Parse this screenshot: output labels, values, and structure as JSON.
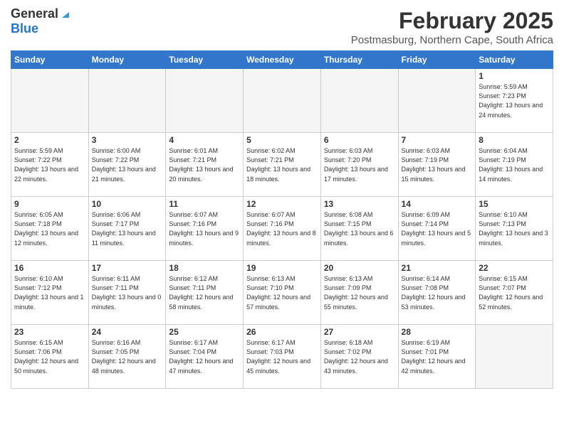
{
  "header": {
    "logo_general": "General",
    "logo_blue": "Blue",
    "main_title": "February 2025",
    "subtitle": "Postmasburg, Northern Cape, South Africa"
  },
  "days_of_week": [
    "Sunday",
    "Monday",
    "Tuesday",
    "Wednesday",
    "Thursday",
    "Friday",
    "Saturday"
  ],
  "weeks": [
    [
      {
        "day": "",
        "empty": true
      },
      {
        "day": "",
        "empty": true
      },
      {
        "day": "",
        "empty": true
      },
      {
        "day": "",
        "empty": true
      },
      {
        "day": "",
        "empty": true
      },
      {
        "day": "",
        "empty": true
      },
      {
        "day": "1",
        "sunrise": "5:59 AM",
        "sunset": "7:23 PM",
        "daylight": "13 hours and 24 minutes."
      }
    ],
    [
      {
        "day": "2",
        "sunrise": "5:59 AM",
        "sunset": "7:22 PM",
        "daylight": "13 hours and 22 minutes."
      },
      {
        "day": "3",
        "sunrise": "6:00 AM",
        "sunset": "7:22 PM",
        "daylight": "13 hours and 21 minutes."
      },
      {
        "day": "4",
        "sunrise": "6:01 AM",
        "sunset": "7:21 PM",
        "daylight": "13 hours and 20 minutes."
      },
      {
        "day": "5",
        "sunrise": "6:02 AM",
        "sunset": "7:21 PM",
        "daylight": "13 hours and 18 minutes."
      },
      {
        "day": "6",
        "sunrise": "6:03 AM",
        "sunset": "7:20 PM",
        "daylight": "13 hours and 17 minutes."
      },
      {
        "day": "7",
        "sunrise": "6:03 AM",
        "sunset": "7:19 PM",
        "daylight": "13 hours and 15 minutes."
      },
      {
        "day": "8",
        "sunrise": "6:04 AM",
        "sunset": "7:19 PM",
        "daylight": "13 hours and 14 minutes."
      }
    ],
    [
      {
        "day": "9",
        "sunrise": "6:05 AM",
        "sunset": "7:18 PM",
        "daylight": "13 hours and 12 minutes."
      },
      {
        "day": "10",
        "sunrise": "6:06 AM",
        "sunset": "7:17 PM",
        "daylight": "13 hours and 11 minutes."
      },
      {
        "day": "11",
        "sunrise": "6:07 AM",
        "sunset": "7:16 PM",
        "daylight": "13 hours and 9 minutes."
      },
      {
        "day": "12",
        "sunrise": "6:07 AM",
        "sunset": "7:16 PM",
        "daylight": "13 hours and 8 minutes."
      },
      {
        "day": "13",
        "sunrise": "6:08 AM",
        "sunset": "7:15 PM",
        "daylight": "13 hours and 6 minutes."
      },
      {
        "day": "14",
        "sunrise": "6:09 AM",
        "sunset": "7:14 PM",
        "daylight": "13 hours and 5 minutes."
      },
      {
        "day": "15",
        "sunrise": "6:10 AM",
        "sunset": "7:13 PM",
        "daylight": "13 hours and 3 minutes."
      }
    ],
    [
      {
        "day": "16",
        "sunrise": "6:10 AM",
        "sunset": "7:12 PM",
        "daylight": "13 hours and 1 minute."
      },
      {
        "day": "17",
        "sunrise": "6:11 AM",
        "sunset": "7:11 PM",
        "daylight": "13 hours and 0 minutes."
      },
      {
        "day": "18",
        "sunrise": "6:12 AM",
        "sunset": "7:11 PM",
        "daylight": "12 hours and 58 minutes."
      },
      {
        "day": "19",
        "sunrise": "6:13 AM",
        "sunset": "7:10 PM",
        "daylight": "12 hours and 57 minutes."
      },
      {
        "day": "20",
        "sunrise": "6:13 AM",
        "sunset": "7:09 PM",
        "daylight": "12 hours and 55 minutes."
      },
      {
        "day": "21",
        "sunrise": "6:14 AM",
        "sunset": "7:08 PM",
        "daylight": "12 hours and 53 minutes."
      },
      {
        "day": "22",
        "sunrise": "6:15 AM",
        "sunset": "7:07 PM",
        "daylight": "12 hours and 52 minutes."
      }
    ],
    [
      {
        "day": "23",
        "sunrise": "6:15 AM",
        "sunset": "7:06 PM",
        "daylight": "12 hours and 50 minutes."
      },
      {
        "day": "24",
        "sunrise": "6:16 AM",
        "sunset": "7:05 PM",
        "daylight": "12 hours and 48 minutes."
      },
      {
        "day": "25",
        "sunrise": "6:17 AM",
        "sunset": "7:04 PM",
        "daylight": "12 hours and 47 minutes."
      },
      {
        "day": "26",
        "sunrise": "6:17 AM",
        "sunset": "7:03 PM",
        "daylight": "12 hours and 45 minutes."
      },
      {
        "day": "27",
        "sunrise": "6:18 AM",
        "sunset": "7:02 PM",
        "daylight": "12 hours and 43 minutes."
      },
      {
        "day": "28",
        "sunrise": "6:19 AM",
        "sunset": "7:01 PM",
        "daylight": "12 hours and 42 minutes."
      },
      {
        "day": "",
        "empty": true
      }
    ]
  ]
}
